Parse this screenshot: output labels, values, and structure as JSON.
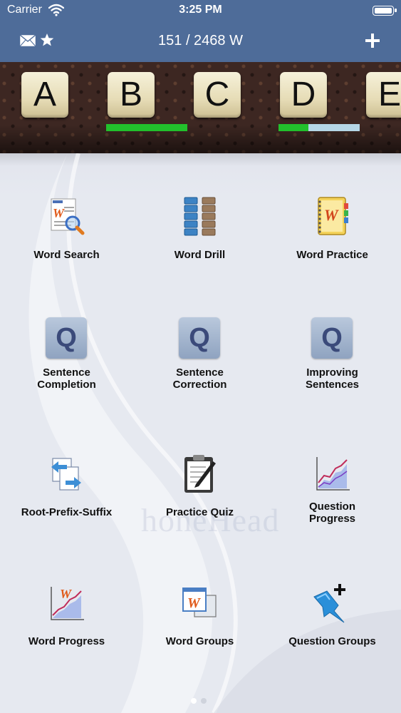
{
  "status_bar": {
    "carrier": "Carrier",
    "time": "3:25 PM"
  },
  "nav_bar": {
    "word_count": "151 / 2468 W"
  },
  "letter_tiles": [
    {
      "letter": "A",
      "progress": null
    },
    {
      "letter": "B",
      "progress": 1.0
    },
    {
      "letter": "C",
      "progress": null
    },
    {
      "letter": "D",
      "progress": 0.37
    },
    {
      "letter": "E",
      "progress": null
    }
  ],
  "menu_items": [
    {
      "label": "Word Search",
      "icon": "word-search-icon"
    },
    {
      "label": "Word Drill",
      "icon": "word-drill-icon"
    },
    {
      "label": "Word Practice",
      "icon": "word-practice-icon"
    },
    {
      "label": "Sentence\nCompletion",
      "icon": "q-icon",
      "icon_letter": "Q"
    },
    {
      "label": "Sentence\nCorrection",
      "icon": "q-icon",
      "icon_letter": "Q"
    },
    {
      "label": "Improving\nSentences",
      "icon": "q-icon",
      "icon_letter": "Q"
    },
    {
      "label": "Root-Prefix-Suffix",
      "icon": "root-prefix-suffix-icon"
    },
    {
      "label": "Practice Quiz",
      "icon": "clipboard-icon"
    },
    {
      "label": "Question\nProgress",
      "icon": "progress-chart-icon"
    },
    {
      "label": "Word Progress",
      "icon": "word-progress-chart-icon"
    },
    {
      "label": "Word Groups",
      "icon": "word-groups-icon"
    },
    {
      "label": "Question Groups",
      "icon": "pin-add-icon"
    }
  ],
  "watermark": "honeHead",
  "page_indicator": {
    "pages": 2,
    "current": 1
  },
  "colors": {
    "nav": "#4e6c99",
    "progress_fill": "#22c02c",
    "progress_track": "#b5d6e6"
  }
}
